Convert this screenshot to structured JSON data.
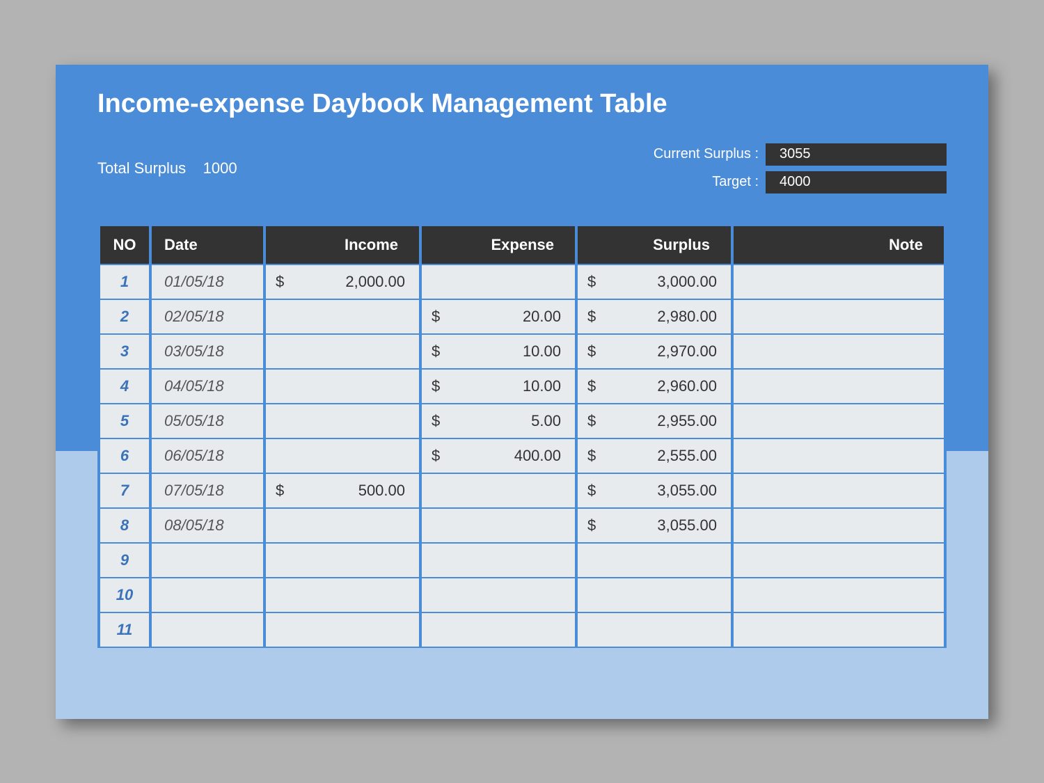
{
  "title": "Income-expense Daybook Management Table",
  "total_surplus_label": "Total Surplus",
  "total_surplus_value": "1000",
  "current_surplus_label": "Current Surplus :",
  "current_surplus_value": "3055",
  "target_label": "Target :",
  "target_value": "4000",
  "columns": {
    "no": "NO",
    "date": "Date",
    "income": "Income",
    "expense": "Expense",
    "surplus": "Surplus",
    "note": "Note"
  },
  "currency_symbol": "$",
  "rows": [
    {
      "no": "1",
      "date": "01/05/18",
      "income": "2,000.00",
      "expense": "",
      "surplus": "3,000.00",
      "note": ""
    },
    {
      "no": "2",
      "date": "02/05/18",
      "income": "",
      "expense": "20.00",
      "surplus": "2,980.00",
      "note": ""
    },
    {
      "no": "3",
      "date": "03/05/18",
      "income": "",
      "expense": "10.00",
      "surplus": "2,970.00",
      "note": ""
    },
    {
      "no": "4",
      "date": "04/05/18",
      "income": "",
      "expense": "10.00",
      "surplus": "2,960.00",
      "note": ""
    },
    {
      "no": "5",
      "date": "05/05/18",
      "income": "",
      "expense": "5.00",
      "surplus": "2,955.00",
      "note": ""
    },
    {
      "no": "6",
      "date": "06/05/18",
      "income": "",
      "expense": "400.00",
      "surplus": "2,555.00",
      "note": ""
    },
    {
      "no": "7",
      "date": "07/05/18",
      "income": "500.00",
      "expense": "",
      "surplus": "3,055.00",
      "note": ""
    },
    {
      "no": "8",
      "date": "08/05/18",
      "income": "",
      "expense": "",
      "surplus": "3,055.00",
      "note": ""
    },
    {
      "no": "9",
      "date": "",
      "income": "",
      "expense": "",
      "surplus": "",
      "note": ""
    },
    {
      "no": "10",
      "date": "",
      "income": "",
      "expense": "",
      "surplus": "",
      "note": ""
    },
    {
      "no": "11",
      "date": "",
      "income": "",
      "expense": "",
      "surplus": "",
      "note": ""
    }
  ]
}
